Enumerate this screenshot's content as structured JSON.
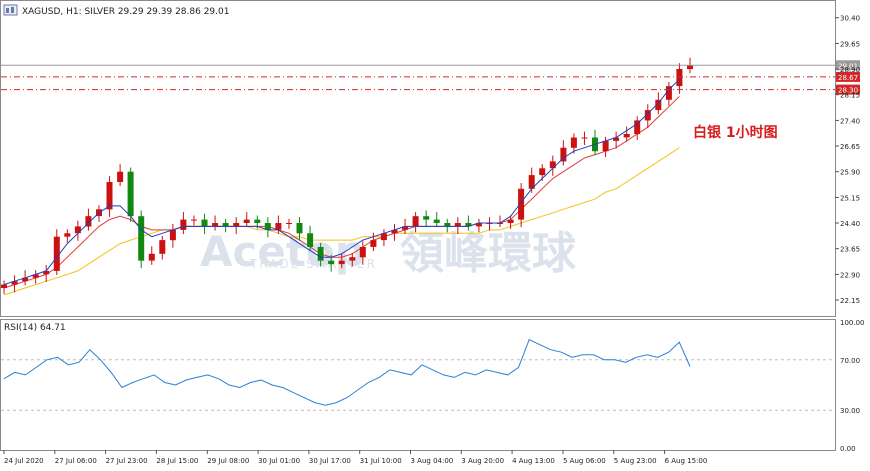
{
  "header": {
    "symbol_line": "XAGUSD, H1: SILVER 29.29 29.39 28.86 29.01"
  },
  "annotation": {
    "cn_label": "白银 1小时图"
  },
  "watermark": {
    "title_en": "Acetop",
    "title_cn": "領峰環球",
    "subtitle": "TRADE SMARTER"
  },
  "colors": {
    "bull_candle": "#cc1111",
    "bear_candle": "#118811",
    "ma_fast": "#1f3fbf",
    "ma_mid": "#e23a3a",
    "ma_slow": "#f3c21a",
    "rsi_line": "#2b7fd6",
    "level_line": "#d22828",
    "annotation_text": "#d81b1b"
  },
  "chart_data": [
    {
      "type": "line",
      "title": "XAGUSD, H1: SILVER 29.29 29.39 28.86 29.01",
      "ylim": [
        21.8,
        30.8
      ],
      "y_ticks": [
        "30.40",
        "29.65",
        "28.90",
        "28.15",
        "27.40",
        "26.65",
        "25.90",
        "25.15",
        "24.40",
        "23.65",
        "22.90",
        "22.15"
      ],
      "x_ticks": [
        "24 Jul 2020",
        "27 Jul 06:00",
        "27 Jul 23:00",
        "28 Jul 15:00",
        "29 Jul 08:00",
        "30 Jul 01:00",
        "30 Jul 17:00",
        "31 Jul 10:00",
        "3 Aug 04:00",
        "3 Aug 20:00",
        "4 Aug 13:00",
        "5 Aug 06:00",
        "5 Aug 23:00",
        "6 Aug 15:00"
      ],
      "series": [
        {
          "name": "",
          "kind": "price",
          "values": [
            22.6,
            22.7,
            22.8,
            22.9,
            23.0,
            24.0,
            24.1,
            24.3,
            24.6,
            24.8,
            25.6,
            25.9,
            24.6,
            23.3,
            23.5,
            23.9,
            24.2,
            24.5,
            24.5,
            24.3,
            24.4,
            24.3,
            24.4,
            24.5,
            24.4,
            24.2,
            24.4,
            24.4,
            24.1,
            23.7,
            23.3,
            23.2,
            23.3,
            23.4,
            23.7,
            23.9,
            24.1,
            24.2,
            24.3,
            24.6,
            24.5,
            24.4,
            24.3,
            24.4,
            24.3,
            24.4,
            24.4,
            24.4,
            24.5,
            25.4,
            25.8,
            26.0,
            26.2,
            26.6,
            26.9,
            26.9,
            26.5,
            26.8,
            26.9,
            27.0,
            27.4,
            27.7,
            28.0,
            28.4,
            28.9,
            29.01
          ]
        },
        {
          "name": "",
          "kind": "ma_fast",
          "values": [
            22.6,
            22.7,
            22.8,
            22.9,
            23.0,
            23.4,
            23.8,
            24.1,
            24.4,
            24.7,
            24.9,
            24.9,
            24.6,
            24.2,
            24.0,
            24.1,
            24.2,
            24.3,
            24.3,
            24.3,
            24.3,
            24.3,
            24.3,
            24.3,
            24.3,
            24.2,
            24.2,
            24.0,
            23.8,
            23.6,
            23.4,
            23.4,
            23.5,
            23.7,
            23.9,
            24.0,
            24.1,
            24.2,
            24.3,
            24.3,
            24.3,
            24.3,
            24.3,
            24.3,
            24.3,
            24.4,
            24.4,
            24.4,
            24.6,
            25.0,
            25.4,
            25.7,
            26.0,
            26.3,
            26.5,
            26.6,
            26.7,
            26.8,
            26.9,
            27.1,
            27.3,
            27.6,
            27.9,
            28.3,
            28.6
          ]
        },
        {
          "name": "",
          "kind": "ma_mid",
          "values": [
            22.5,
            22.6,
            22.7,
            22.8,
            22.9,
            23.1,
            23.4,
            23.7,
            24.0,
            24.3,
            24.5,
            24.6,
            24.5,
            24.3,
            24.2,
            24.2,
            24.2,
            24.3,
            24.3,
            24.3,
            24.3,
            24.3,
            24.3,
            24.3,
            24.3,
            24.3,
            24.2,
            24.1,
            23.9,
            23.7,
            23.5,
            23.4,
            23.4,
            23.5,
            23.7,
            23.9,
            24.0,
            24.1,
            24.2,
            24.3,
            24.3,
            24.3,
            24.3,
            24.3,
            24.3,
            24.4,
            24.4,
            24.4,
            24.5,
            24.8,
            25.1,
            25.4,
            25.7,
            25.9,
            26.1,
            26.3,
            26.4,
            26.5,
            26.6,
            26.8,
            27.0,
            27.2,
            27.5,
            27.8,
            28.1
          ]
        },
        {
          "name": "",
          "kind": "ma_slow",
          "values": [
            22.3,
            22.4,
            22.5,
            22.6,
            22.7,
            22.8,
            22.9,
            23.0,
            23.2,
            23.4,
            23.6,
            23.8,
            23.9,
            24.0,
            24.1,
            24.2,
            24.2,
            24.3,
            24.3,
            24.3,
            24.3,
            24.3,
            24.3,
            24.3,
            24.2,
            24.2,
            24.1,
            24.0,
            24.0,
            23.9,
            23.9,
            23.9,
            23.9,
            23.9,
            24.0,
            24.0,
            24.0,
            24.1,
            24.1,
            24.1,
            24.1,
            24.1,
            24.1,
            24.1,
            24.1,
            24.1,
            24.2,
            24.2,
            24.3,
            24.4,
            24.5,
            24.6,
            24.7,
            24.8,
            24.9,
            25.0,
            25.1,
            25.3,
            25.4,
            25.6,
            25.8,
            26.0,
            26.2,
            26.4,
            26.6
          ]
        }
      ],
      "price_levels": [
        {
          "value": 29.01,
          "label": "29.01",
          "style": "solid-gray"
        },
        {
          "value": 28.67,
          "label": "28.67",
          "style": "dashdot-red"
        },
        {
          "value": 28.3,
          "label": "28.30",
          "style": "dashdot-red"
        }
      ],
      "grid": false
    },
    {
      "type": "line",
      "title": "RSI(14) 64.71",
      "ylim": [
        0,
        100
      ],
      "y_ticks": [
        "100.00",
        "70.00",
        "30.00",
        "0.00"
      ],
      "reference_lines": [
        70,
        30
      ],
      "series": [
        {
          "name": "RSI(14)",
          "values": [
            55,
            60,
            58,
            64,
            70,
            72,
            66,
            68,
            78,
            70,
            60,
            48,
            52,
            55,
            58,
            52,
            50,
            54,
            56,
            58,
            55,
            50,
            48,
            52,
            54,
            50,
            48,
            44,
            40,
            36,
            34,
            36,
            40,
            46,
            52,
            56,
            62,
            60,
            58,
            66,
            62,
            58,
            56,
            60,
            58,
            62,
            60,
            58,
            64,
            86,
            82,
            78,
            76,
            72,
            74,
            74,
            70,
            70,
            68,
            72,
            74,
            72,
            76,
            84,
            64.71
          ]
        }
      ]
    }
  ]
}
